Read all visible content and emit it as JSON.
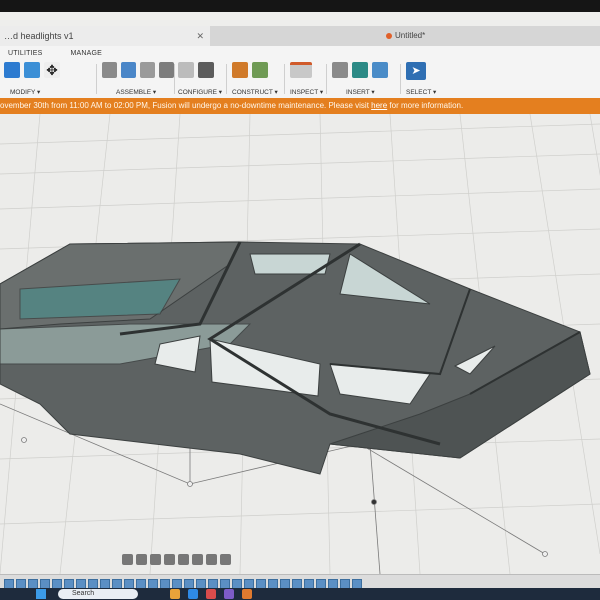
{
  "window": {
    "doc_tab_title": "…d headlights v1",
    "doc_tab_close": "✕",
    "doc_title": "Untitled*"
  },
  "toolbar": {
    "tabs": [
      "UTILITIES",
      "MANAGE"
    ],
    "groups": {
      "modify": "MODIFY ▾",
      "assemble": "ASSEMBLE ▾",
      "configure": "CONFIGURE ▾",
      "construct": "CONSTRUCT ▾",
      "inspect": "INSPECT ▾",
      "insert": "INSERT ▾",
      "select": "SELECT ▾"
    }
  },
  "banner": {
    "text": "ovember 30th from 11:00 AM to 02:00 PM, Fusion will undergo a no-downtime maintenance. Please visit ",
    "link": "here",
    "suffix": " for more information."
  },
  "taskbar": {
    "search_placeholder": "Search"
  },
  "colors": {
    "banner": "#e47f1f",
    "body_shell": "#5d6262",
    "glass": "#9fb4b0",
    "select_accent": "#2f6fb3"
  }
}
